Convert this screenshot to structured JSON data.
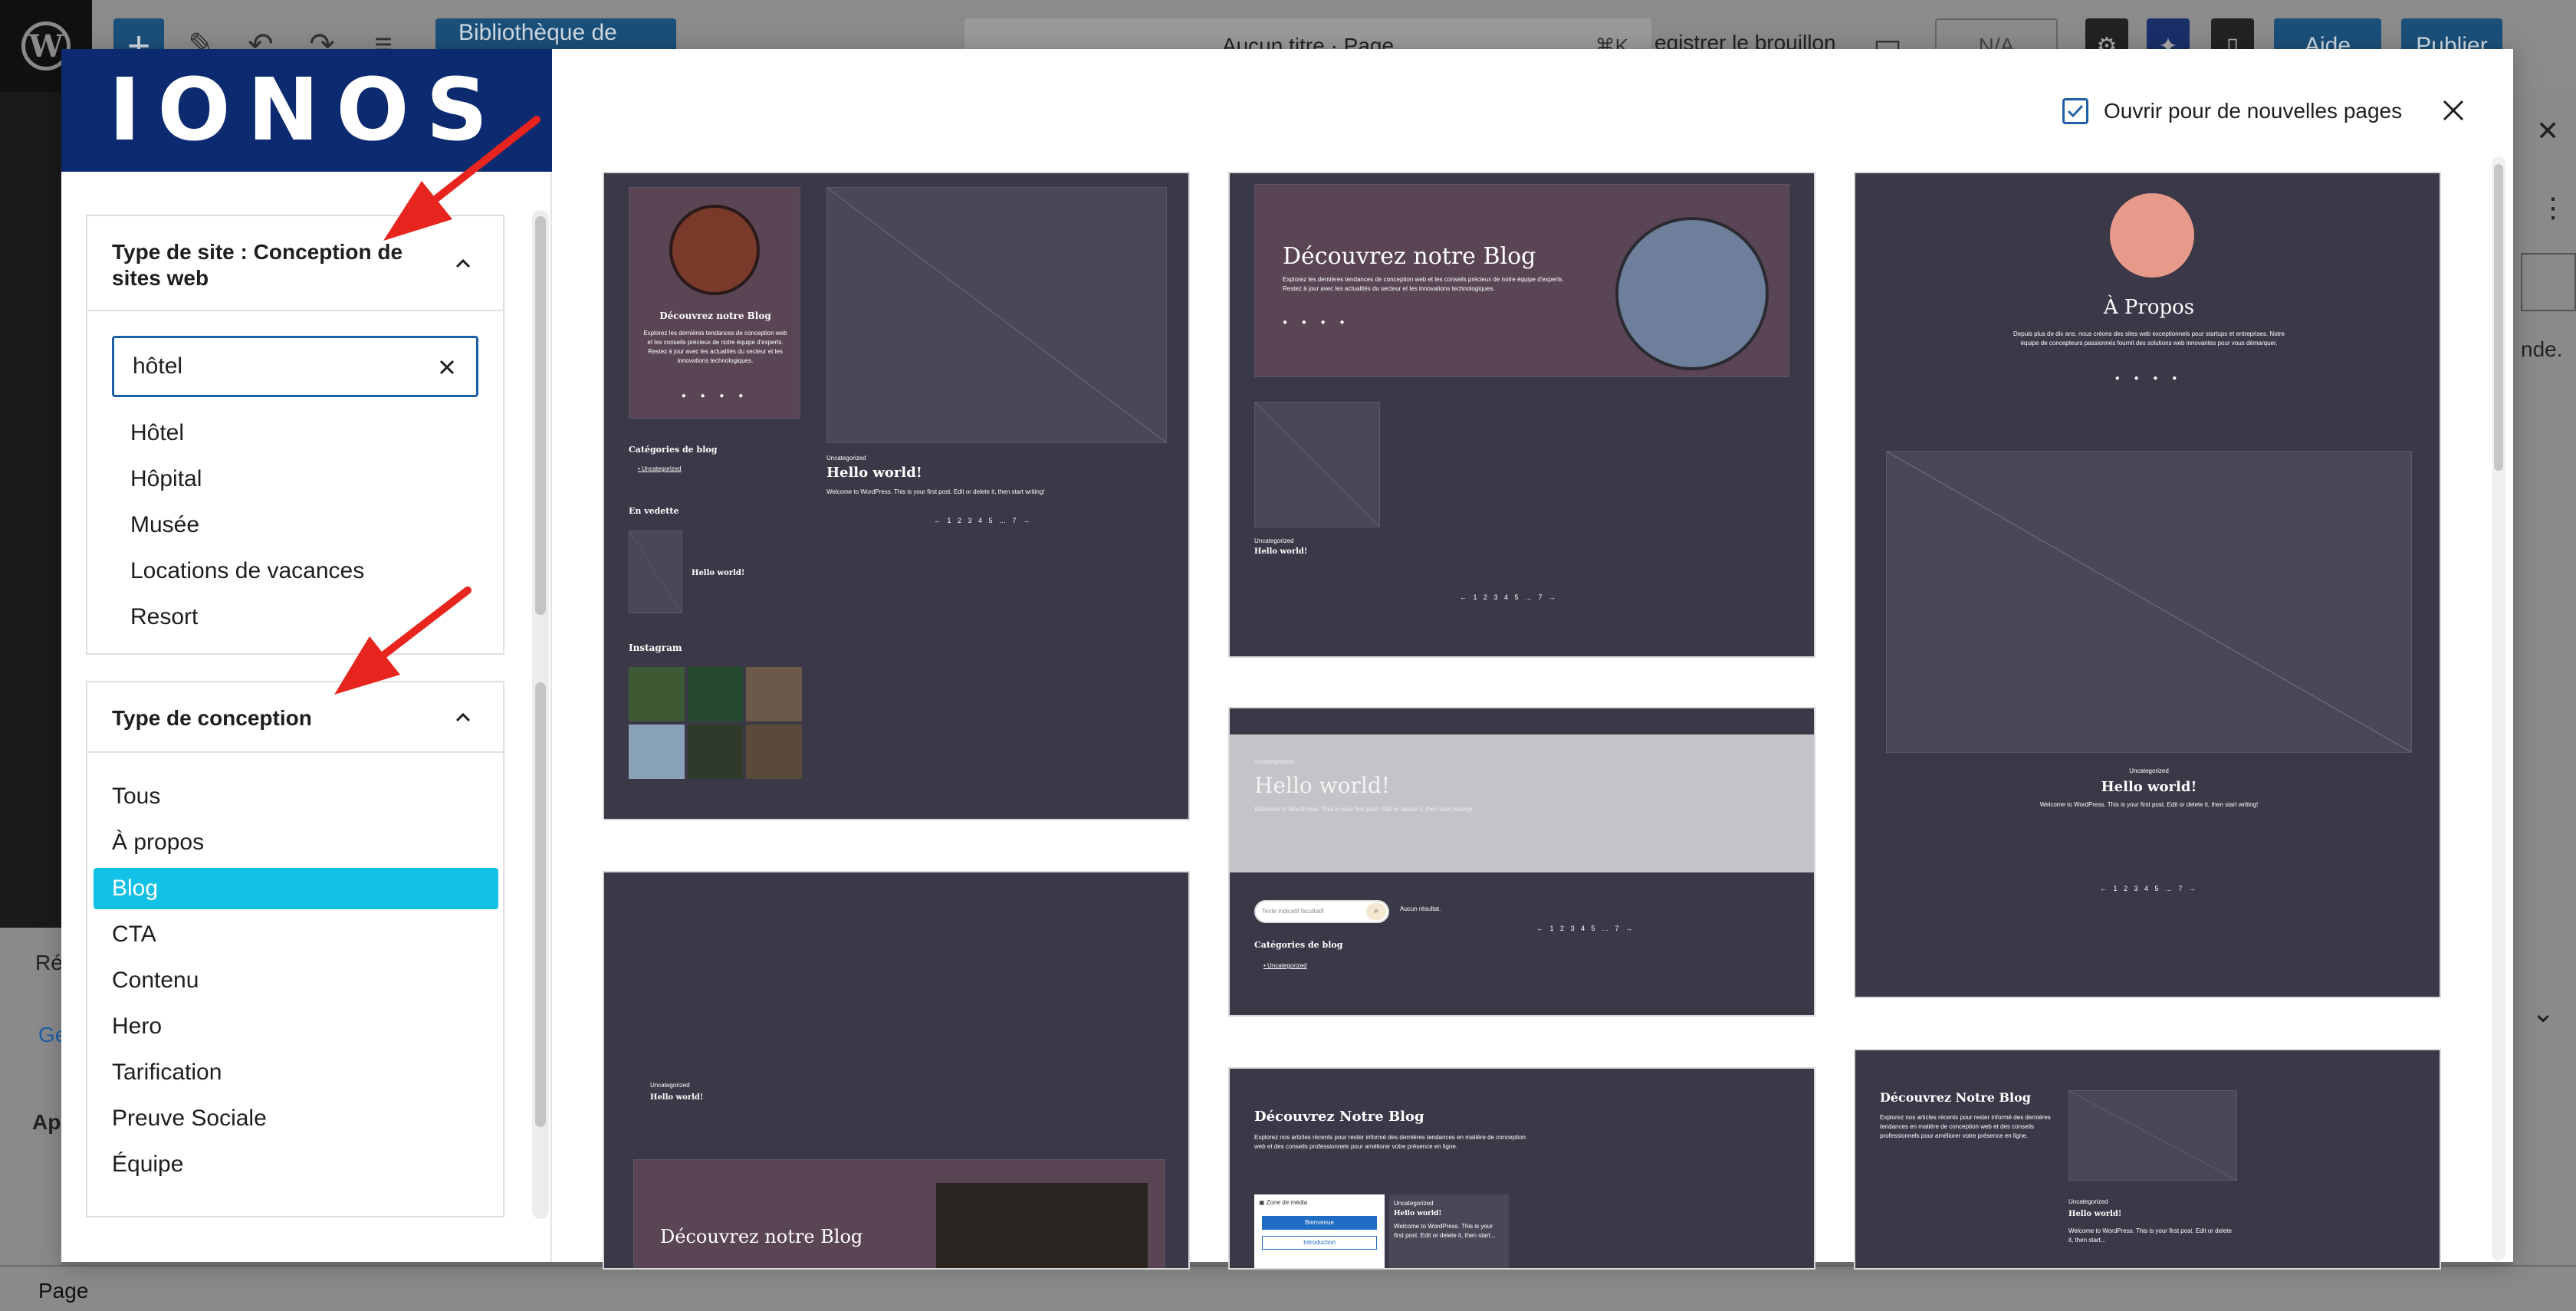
{
  "editor": {
    "library_button": "Bibliothèque de design",
    "doc_title": "Aucun titre · Page",
    "shortcut": "⌘K",
    "save_draft": "egistrer le brouillon",
    "na_label": "N/A",
    "help_label": "Aide",
    "publish_label": "Publier",
    "footer_label": "Page",
    "left_partial_1": "Ré",
    "left_partial_2": "Ge",
    "left_partial_3": "Ap",
    "right_partial": "nde."
  },
  "brand": {
    "logo_text": "IONOS",
    "color": "#0b2a6f"
  },
  "site_type": {
    "title": "Type de site : Conception de sites web",
    "search_value": "hôtel",
    "suggestions": [
      "Hôtel",
      "Hôpital",
      "Musée",
      "Locations de vacances",
      "Resort"
    ]
  },
  "design_type": {
    "title": "Type de conception",
    "options": [
      "Tous",
      "À propos",
      "Blog",
      "CTA",
      "Contenu",
      "Hero",
      "Tarification",
      "Preuve Sociale",
      "Équipe"
    ],
    "selected": "Blog",
    "selected_color": "#12c1e5"
  },
  "top": {
    "open_new_pages_label": "Ouvrir pour de nouvelles pages",
    "open_new_pages_checked": true
  },
  "cards": {
    "c1": {
      "heading": "Découvrez notre Blog",
      "desc": "Explorez les dernières tendances de conception web et les conseils précieux de notre équipe d'experts. Restez à jour avec les actualités du secteur et les innovations technologiques.",
      "categories_title": "Catégories de blog",
      "category": "Uncategorized",
      "post_category": "Uncategorized",
      "post_title": "Hello world!",
      "post_excerpt": "Welcome to WordPress. This is your first post. Edit or delete it, then start writing!",
      "pager": "← 1 2 3 4 5 … 7 →",
      "featured_title": "En vedette",
      "featured_post": "Hello world!",
      "instagram_title": "Instagram"
    },
    "c2": {
      "heading": "Découvrez notre Blog",
      "desc": "Explorez les dernières tendances de conception web et les conseils précieux de notre équipe d'experts. Restez à jour avec les actualités du secteur et les innovations technologiques.",
      "post_category": "Uncategorized",
      "post_title": "Hello world!",
      "pager": "← 1 2 3 4 5 … 7 →"
    },
    "c3": {
      "heading": "À Propos",
      "desc": "Depuis plus de dix ans, nous créons des sites web exceptionnels pour startups et entreprises. Notre équipe de concepteurs passionnés fournit des solutions web innovantes pour vous démarquer.",
      "post_category": "Uncategorized",
      "post_title": "Hello world!",
      "post_excerpt": "Welcome to WordPress. This is your first post. Edit or delete it, then start writing!",
      "pager": "← 1 2 3 4 5 … 7 →"
    },
    "c4": {
      "category": "Uncategorized",
      "title": "Hello world!",
      "excerpt": "Welcome to WordPress. This is your first post. Edit or delete it, then start writing!",
      "search_placeholder": "Texte indicatif facultatif",
      "no_result": "Aucun résultat.",
      "pager": "← 1 2 3 4 5 … 7 →",
      "categories_title": "Catégories de blog",
      "category_item": "Uncategorized"
    },
    "c5": {
      "post_category": "Uncategorized",
      "post_title": "Hello world!",
      "heading": "Découvrez notre Blog"
    },
    "c6": {
      "heading": "Découvrez Notre Blog",
      "desc": "Explorez nos articles récents pour rester informé des dernières tendances en matière de conception web et des conseils professionnels pour améliorer votre présence en ligne.",
      "media_label": "Zone de média",
      "btn1": "Bienvenue",
      "btn2": "Introduction",
      "post_category": "Uncategorized",
      "post_title": "Hello world!",
      "post_excerpt": "Welcome to WordPress. This is your first post. Edit or delete it, then start..."
    },
    "c7": {
      "heading": "Découvrez Notre Blog",
      "desc": "Explorez nos articles récents pour rester informé des dernières tendances en matière de conception web et des conseils professionnels pour améliorer votre présence en ligne.",
      "post_category": "Uncategorized",
      "post_title": "Hello world!",
      "post_excerpt": "Welcome to WordPress. This is your first post. Edit or delete it, then start..."
    }
  }
}
